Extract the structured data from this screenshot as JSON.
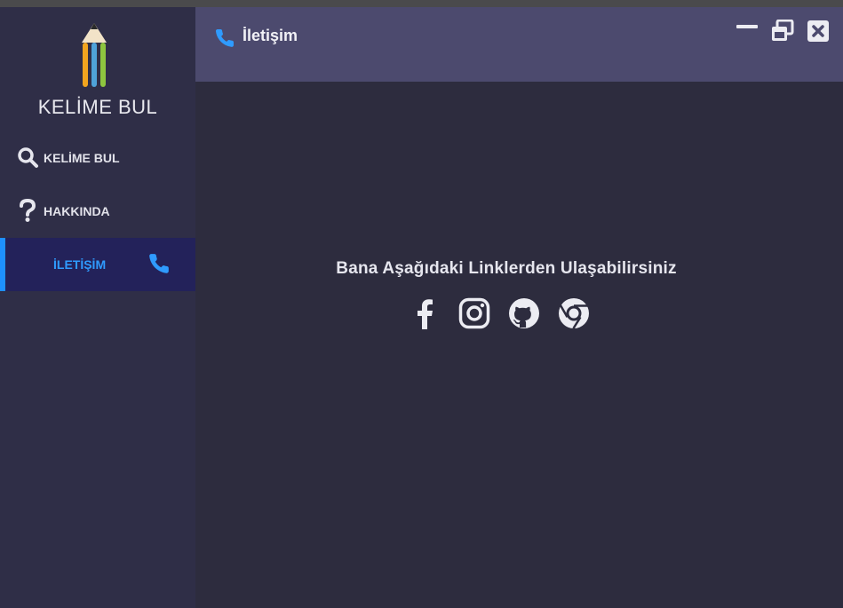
{
  "app": {
    "name": "KELİME BUL"
  },
  "sidebar": {
    "items": [
      {
        "label": "KELİME BUL",
        "icon": "search-icon"
      },
      {
        "label": "HAKKINDA",
        "icon": "question-icon"
      },
      {
        "label": "İLETİŞİM",
        "icon": "phone-icon",
        "active": true
      }
    ]
  },
  "header": {
    "title": "İletişim",
    "icon": "phone-icon"
  },
  "window_controls": [
    "minimize-icon",
    "restore-icon",
    "close-icon"
  ],
  "main": {
    "message": "Bana Aşağıdaki Linklerden Ulaşabilirsiniz",
    "links": [
      "facebook-icon",
      "instagram-icon",
      "github-icon",
      "chrome-icon"
    ]
  },
  "colors": {
    "accent": "#1e90ff",
    "sidebar": "#2f2e47",
    "header": "#4c4a6e",
    "background": "#2d2c3e",
    "active_item": "#23225a"
  }
}
